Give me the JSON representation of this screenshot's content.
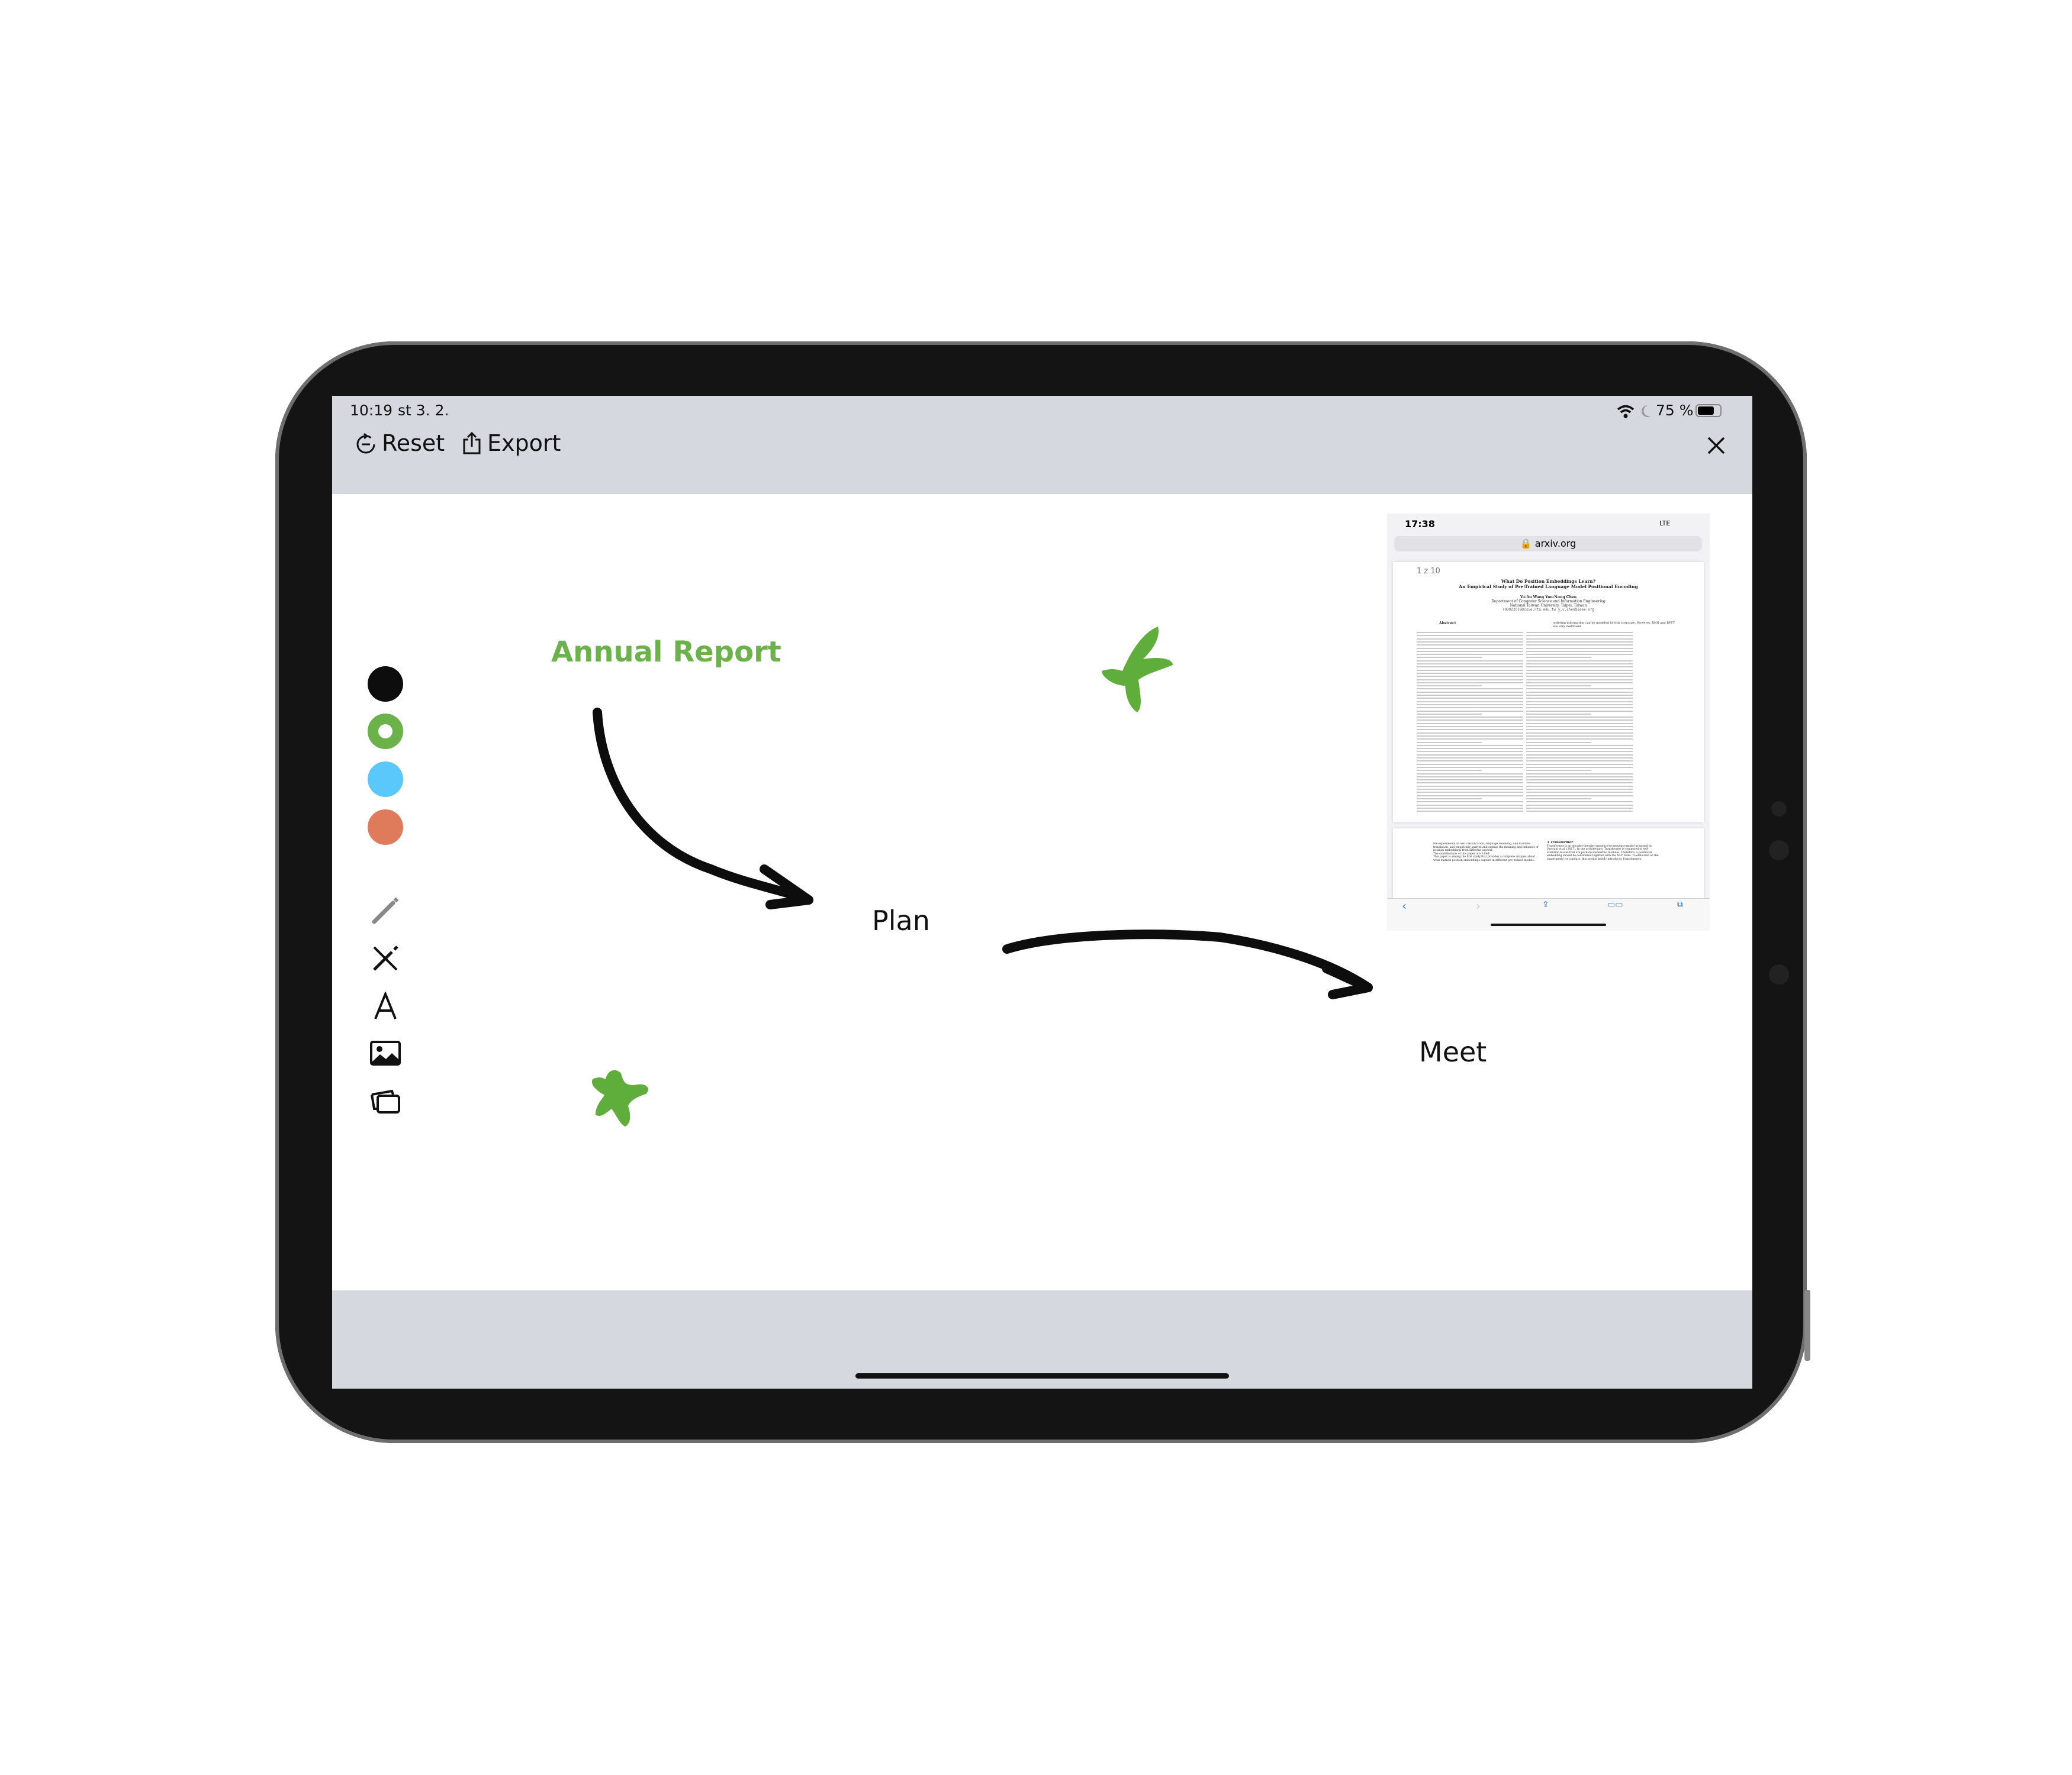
{
  "status_bar": {
    "time": "10:19",
    "date": "st 3. 2.",
    "battery": "75 %",
    "battery_level": 0.75,
    "icons": [
      "wifi-icon",
      "moon-icon",
      "battery-icon"
    ]
  },
  "toolbar": {
    "reset_label": "Reset",
    "export_label": "Export",
    "close_icon": "close-icon"
  },
  "palette": {
    "colors": [
      "#0d0d0d",
      "#6cb24a",
      "#5ac8fa",
      "#df7a5b"
    ],
    "selected_index": 1
  },
  "tools": [
    "pencil-icon",
    "pen-eraser-icon",
    "text-icon",
    "image-icon",
    "layers-icon"
  ],
  "canvas": {
    "annual_report": "Annual Report",
    "annual_report_color": "#6cb24a",
    "plan": "Plan",
    "meet": "Meet",
    "ink_color": "#0d0d0d",
    "star_color": "#5fae3c"
  },
  "embedded_screenshot": {
    "time": "17:38",
    "signal": "LTE",
    "url": "arxiv.org",
    "page_counter": "1 z 10",
    "title_line1": "What Do Position Embeddings Learn?",
    "title_line2": "An Empirical Study of Pre-Trained Language Model Positional Encoding",
    "authors": "Yu-An Wang    Yun-Nung Chen",
    "affiliation1": "Department of Computer Science and Information Engineering",
    "affiliation2": "National Taiwan University, Taipei, Taiwan",
    "emails": "r08922019@csie.ntu.edu.tw   y.v.chen@ieee.org",
    "abstract_heading": "Abstract",
    "col2_start": "ordering information can be modeled by this structure. However, RNN and BPTT are very inefficient",
    "page2_left": "the experiments on text classification, language modeling, and machine translation, and empirically analyze and explain the meaning and influence of position embeddings from different aspects.",
    "page2_contrib": "The contributions of this paper are 3-fold:",
    "page2_bullet": "This paper is among the first study that provides a complete analysis about what learned position embeddings capture in different pre-trained models.",
    "section3": "3   Transformer",
    "section3_text": "Transformer is an encoder-decoder sequence-to-sequence model proposed by Vaswani et al. (2017). In the architecture, Transformer is composed of self-attention blocks that are position-insensitive modules. Therefore, a positional embedding should be considered together with the NLP tasks. To elaborate on the experiments we conduct, this section briefly introduces Transformers."
  }
}
